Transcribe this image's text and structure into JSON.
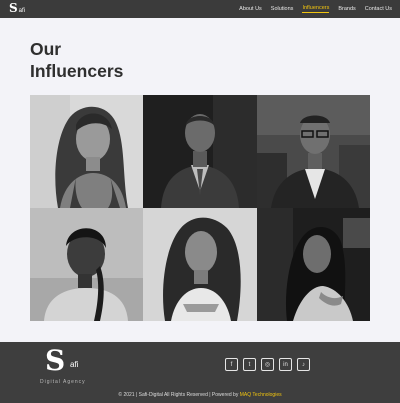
{
  "header": {
    "logo_letter": "S",
    "logo_word": "afi",
    "nav": [
      {
        "label": "About Us"
      },
      {
        "label": "Solutions"
      },
      {
        "label": "Influencers",
        "active": true
      },
      {
        "label": "Brands"
      },
      {
        "label": "Contact Us"
      }
    ]
  },
  "page": {
    "title_line1": "Our",
    "title_line2": "Influencers"
  },
  "influencers": [
    {
      "photo_name": "influencer-photo-1"
    },
    {
      "photo_name": "influencer-photo-2"
    },
    {
      "photo_name": "influencer-photo-3"
    },
    {
      "photo_name": "influencer-photo-4"
    },
    {
      "photo_name": "influencer-photo-5"
    },
    {
      "photo_name": "influencer-photo-6"
    }
  ],
  "footer": {
    "logo_letter": "S",
    "logo_word": "afi",
    "tagline": "Digital Agency",
    "socials": [
      {
        "icon": "facebook-icon",
        "glyph": "f"
      },
      {
        "icon": "twitter-icon",
        "glyph": "t"
      },
      {
        "icon": "instagram-icon",
        "glyph": "◎"
      },
      {
        "icon": "linkedin-icon",
        "glyph": "in"
      },
      {
        "icon": "tiktok-icon",
        "glyph": "♪"
      }
    ],
    "copyright_prefix": "© 2021 | Safi-Digital All Rights Reserved | Powered by ",
    "copyright_company": "MAQ Technologies"
  },
  "colors": {
    "nav_bg": "#3b3b3b",
    "accent": "#f1c40f",
    "page_bg": "#f3f3f8",
    "footer_bg": "#3e3e3e"
  }
}
